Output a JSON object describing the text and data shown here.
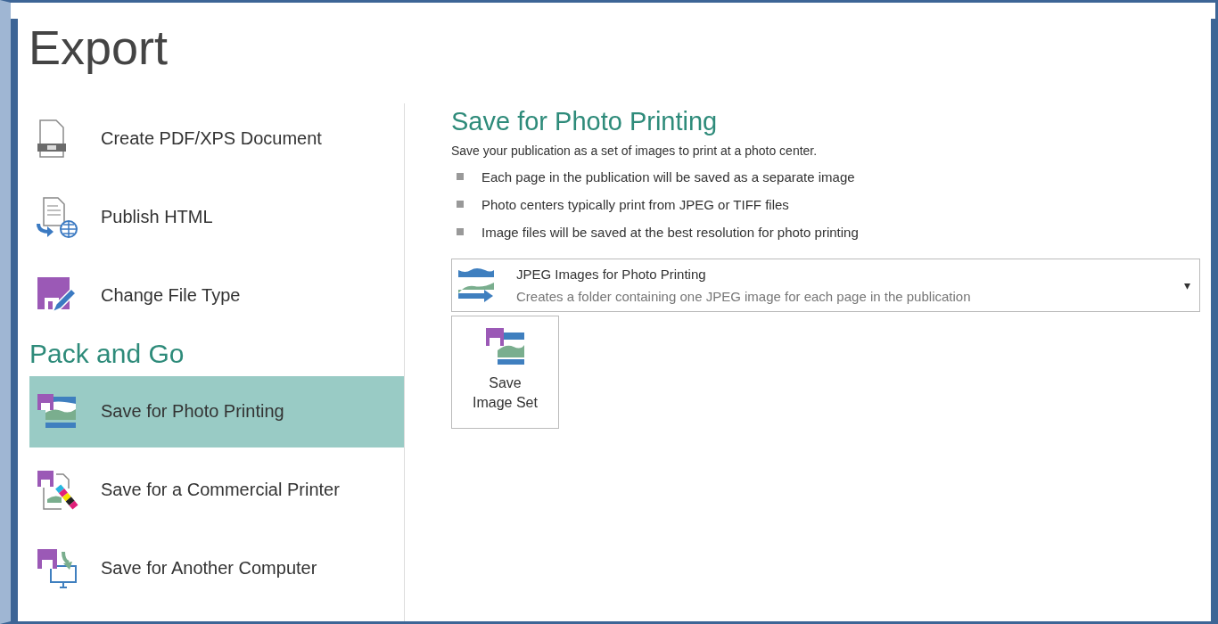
{
  "page_title": "Export",
  "export_options": [
    {
      "label": "Create PDF/XPS Document",
      "selected": false
    },
    {
      "label": "Publish HTML",
      "selected": false
    },
    {
      "label": "Change File Type",
      "selected": false
    }
  ],
  "pack_and_go": {
    "heading": "Pack and Go",
    "items": [
      {
        "label": "Save for Photo Printing",
        "selected": true
      },
      {
        "label": "Save for a Commercial Printer",
        "selected": false
      },
      {
        "label": "Save for Another Computer",
        "selected": false
      }
    ]
  },
  "detail": {
    "title": "Save for Photo Printing",
    "description": "Save your publication as a set of images to print at a photo center.",
    "bullets": [
      "Each page in the publication will be saved as a separate image",
      "Photo centers typically print from JPEG or TIFF files",
      "Image files will be saved at the best resolution for photo printing"
    ],
    "format_dropdown": {
      "title": "JPEG Images for Photo Printing",
      "subtitle": "Creates a folder containing one JPEG image for each page in the publication",
      "caret": "▾"
    },
    "action_button": "Save\nImage Set"
  }
}
